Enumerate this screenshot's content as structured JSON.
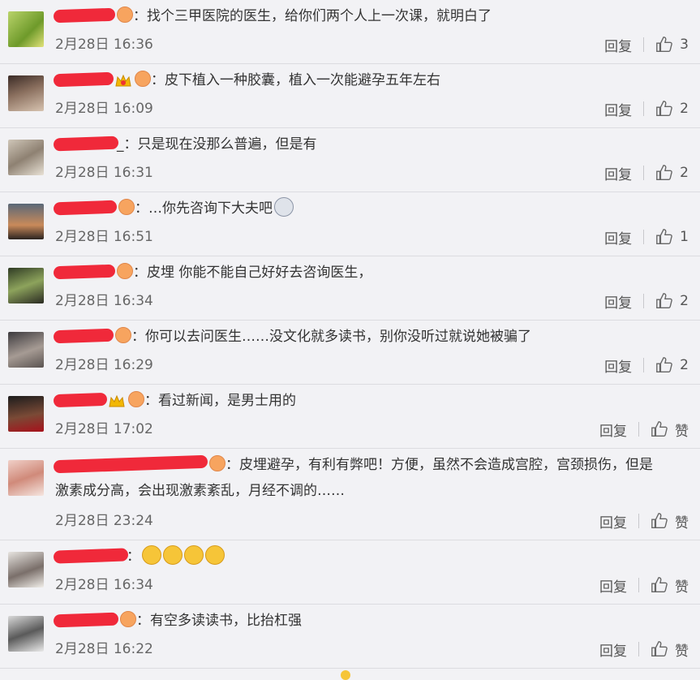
{
  "comments": [
    {
      "name": "",
      "text": "找个三甲医院的医生，给你们两个人上一次课，就明白了",
      "time": "2月28日 16:36",
      "reply": "回复",
      "likes": "3"
    },
    {
      "name": "",
      "text": "皮下植入一种胶囊，植入一次能避孕五年左右",
      "time": "2月28日 16:09",
      "reply": "回复",
      "likes": "2"
    },
    {
      "name": "_",
      "text": "只是现在没那么普遍，但是有",
      "time": "2月28日 16:31",
      "reply": "回复",
      "likes": "2"
    },
    {
      "name": "",
      "text": "…你先咨询下大夫吧",
      "time": "2月28日 16:51",
      "reply": "回复",
      "likes": "1"
    },
    {
      "name": "",
      "text": "皮埋  你能不能自己好好去咨询医生，",
      "time": "2月28日 16:34",
      "reply": "回复",
      "likes": "2"
    },
    {
      "name": "",
      "text": "你可以去问医生……没文化就多读书，别你没听过就说她被骗了",
      "time": "2月28日 16:29",
      "reply": "回复",
      "likes": "2"
    },
    {
      "name": "",
      "text": "看过新闻，是男士用的",
      "time": "2月28日 17:02",
      "reply": "回复",
      "likes": "赞"
    },
    {
      "name": "",
      "text": "皮埋避孕，有利有弊吧！方便，虽然不会造成宫腔，宫颈损伤，但是",
      "text2": "激素成分高，会出现激素紊乱，月经不调的……",
      "time": "2月28日 23:24",
      "reply": "回复",
      "likes": "赞"
    },
    {
      "name": "",
      "text": "",
      "time": "2月28日 16:34",
      "reply": "回复",
      "likes": "赞"
    },
    {
      "name": "",
      "text": "有空多读读书，比抬杠强",
      "time": "2月28日 16:22",
      "reply": "回复",
      "likes": "赞"
    }
  ],
  "colon": "："
}
